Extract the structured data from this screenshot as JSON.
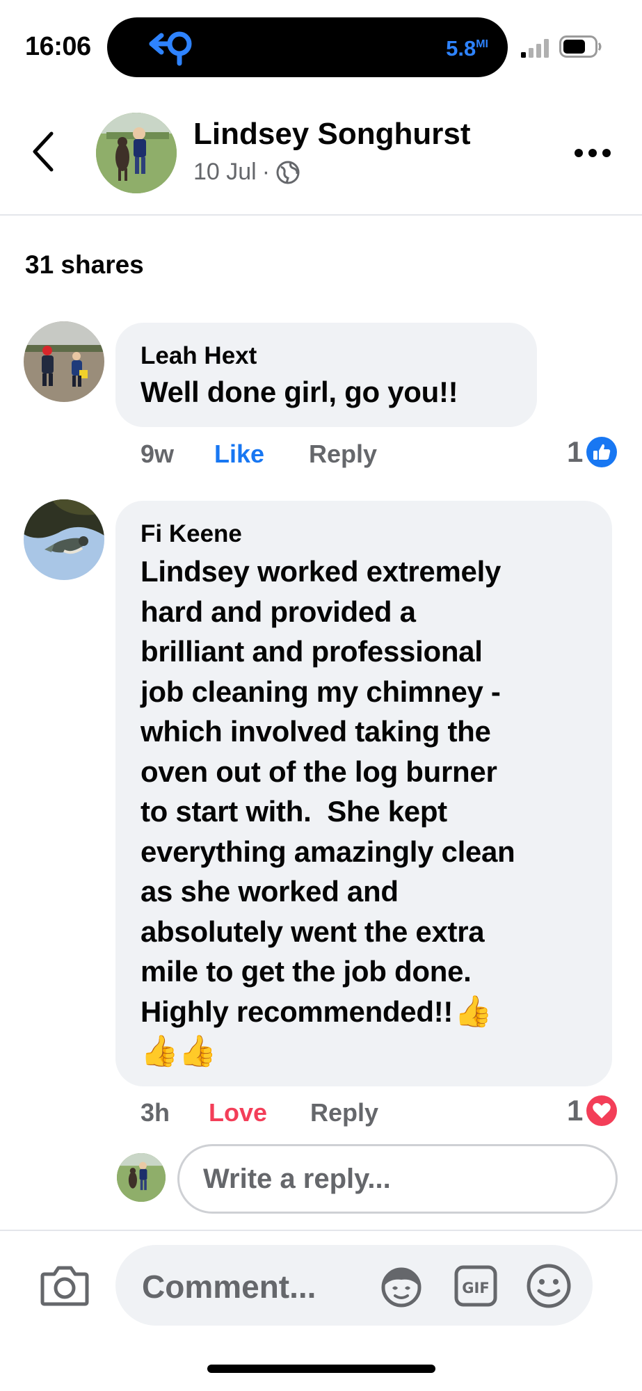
{
  "status_bar": {
    "time": "16:06",
    "island_speed": "5.8",
    "island_unit": "MI",
    "accent_color": "#2e83ff"
  },
  "post": {
    "author": "Lindsey Songhurst",
    "date": "10 Jul",
    "separator": "·",
    "privacy_icon": "globe-icon",
    "shares": "31 shares"
  },
  "comments": [
    {
      "name": "Leah Hext",
      "text": "Well done girl, go you!!",
      "time": "9w",
      "like_label": "Like",
      "reply_label": "Reply",
      "reaction_count": "1",
      "reaction": "like",
      "reaction_color": "#1877f2"
    },
    {
      "name": "Fi Keene",
      "lines": [
        "Lindsey worked extremely",
        "hard and provided a",
        "brilliant and professional",
        "job cleaning my chimney -",
        "which involved taking the",
        "oven out of the log burner",
        "to start with.  She kept",
        "everything amazingly clean",
        "as she worked and",
        "absolutely went the extra",
        "mile to get the job done.",
        "Highly recommended!!"
      ],
      "emoji_end": "👍",
      "emoji_line": "👍👍",
      "time": "3h",
      "like_label": "Love",
      "reply_label": "Reply",
      "reaction_count": "1",
      "reaction": "love",
      "reaction_color": "#f33e58"
    }
  ],
  "reply_box": {
    "placeholder": "Write a reply..."
  },
  "composer": {
    "placeholder": "Comment..."
  }
}
